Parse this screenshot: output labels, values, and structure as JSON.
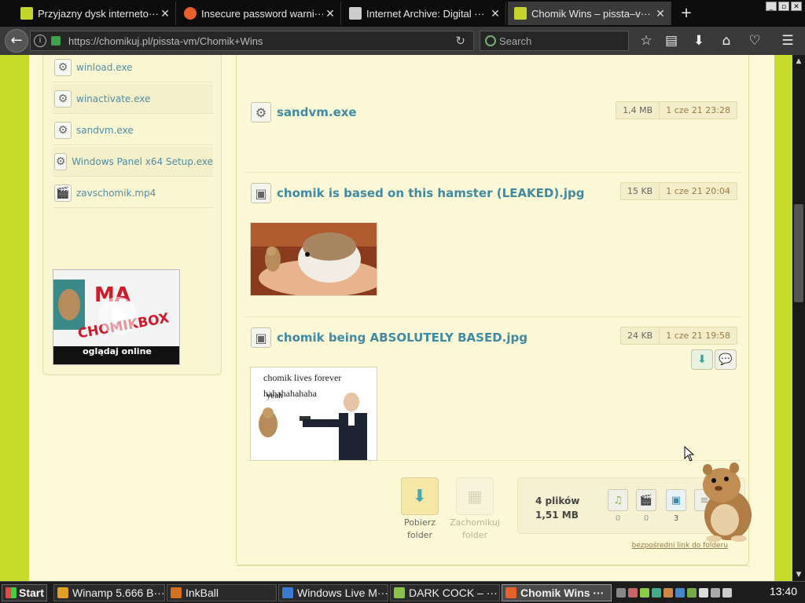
{
  "browser": {
    "tabs": [
      {
        "title": "Przyjazny dysk interneto···",
        "favicon_color": "#c4d42a"
      },
      {
        "title": "Insecure password warni···",
        "favicon_color": "#e8602c"
      },
      {
        "title": "Internet Archive: Digital ···",
        "favicon_color": "#cccccc"
      },
      {
        "title": "Chomik Wins – pissta–v···",
        "favicon_color": "#c4d42a",
        "active": true
      }
    ],
    "url": "https://chomikuj.pl/pissta-vm/Chomik+Wins",
    "search_placeholder": "Search"
  },
  "sidebar": {
    "items": [
      {
        "label": "winload.exe",
        "icon": "gear-icon"
      },
      {
        "label": "winactivate.exe",
        "icon": "gear-icon"
      },
      {
        "label": "sandvm.exe",
        "icon": "gear-icon"
      },
      {
        "label": "Windows Panel x64 Setup.exe",
        "icon": "gear-icon"
      },
      {
        "label": "zavschomik.mp4",
        "icon": "video-icon"
      }
    ],
    "video_thumb": {
      "caption": "oglądaj online",
      "overlay_text": "MA\nCHOMIKBOX"
    }
  },
  "files": [
    {
      "name": "sandvm.exe",
      "size": "1,4 MB",
      "date": "1 cze 21 23:28",
      "icon": "gear-icon"
    },
    {
      "name": "chomik is based on this hamster (LEAKED).jpg",
      "size": "15 KB",
      "date": "1 cze 21 20:04",
      "icon": "image-icon"
    },
    {
      "name": "chomik being ABSOLUTELY BASED.jpg",
      "size": "24 KB",
      "date": "1 cze 21 19:58",
      "icon": "image-icon",
      "thumb_text_1": "chomik lives forever",
      "thumb_text_2": "hahahahahaha",
      "thumb_text_3": "yeah"
    }
  ],
  "footer": {
    "download_folder": "Pobierz folder",
    "keep_folder": "Zachomikuj folder",
    "files_count": "4 plików",
    "total_size": "1,51 MB",
    "type_counts": [
      {
        "icon": "music-icon",
        "count": "0"
      },
      {
        "icon": "video-icon",
        "count": "0"
      },
      {
        "icon": "image-icon",
        "count": "3"
      },
      {
        "icon": "document-icon",
        "count": ""
      }
    ],
    "direct_link": "bezpośredni link do folderu"
  },
  "taskbar": {
    "start": "Start",
    "buttons": [
      {
        "label": "Winamp 5.666 B···",
        "color": "#e0a020"
      },
      {
        "label": "InkBall",
        "color": "#d07020"
      },
      {
        "label": "Windows Live M···",
        "color": "#3a7ad0"
      },
      {
        "label": "DARK COCK – ···",
        "color": "#8bc34a"
      },
      {
        "label": "Chomik Wins ···",
        "color": "#e8602c",
        "active": true
      }
    ],
    "clock": "13:40"
  },
  "colors": {
    "accent_green": "#c6dc2a",
    "link_blue": "#3f8ba3",
    "page_cream": "#fcf7d4"
  }
}
